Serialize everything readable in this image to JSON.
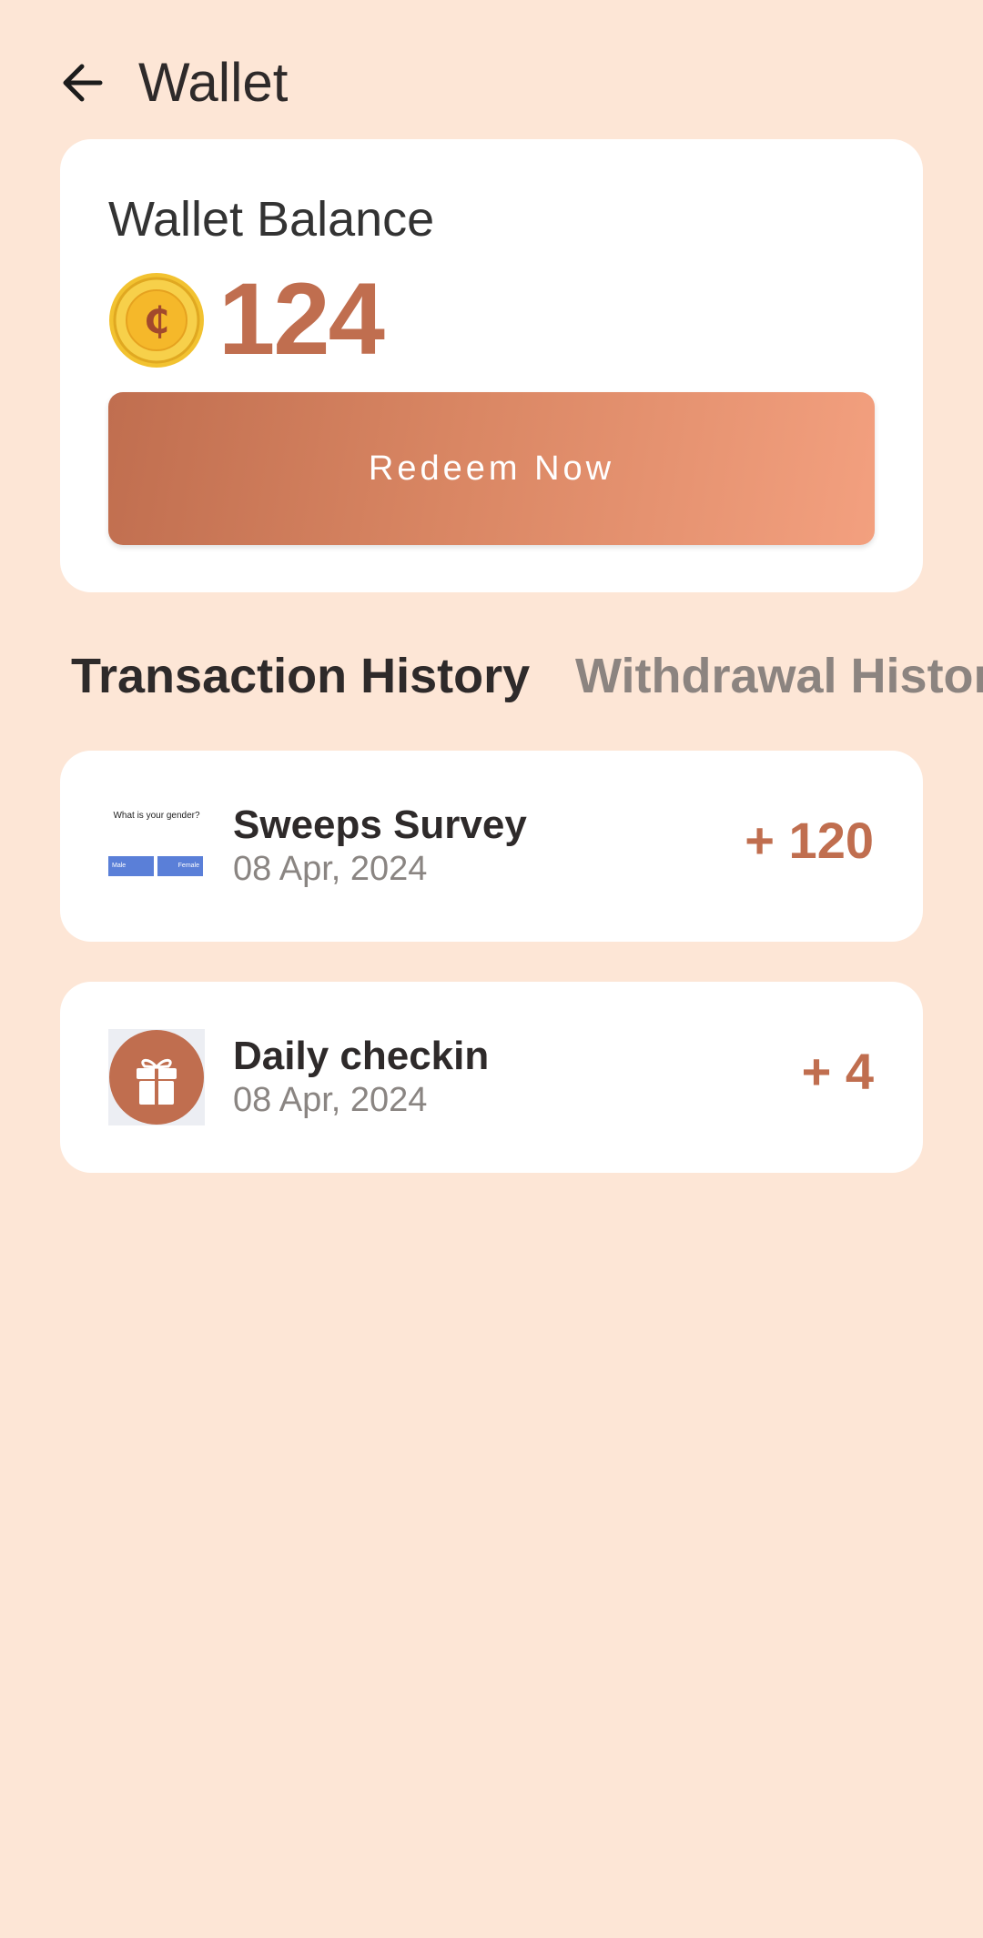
{
  "header": {
    "title": "Wallet",
    "back_icon": "arrow-left-icon"
  },
  "balance_card": {
    "label": "Wallet Balance",
    "coin_icon": "coin-icon",
    "amount": "124",
    "redeem_label": "Redeem Now"
  },
  "tabs": [
    {
      "label": "Transaction History",
      "active": true
    },
    {
      "label": "Withdrawal History",
      "active": false
    }
  ],
  "transactions": [
    {
      "title": "Sweeps Survey",
      "date": "08 Apr, 2024",
      "amount": "+ 120",
      "thumb": {
        "question": "What is your gender?",
        "option_a": "Male",
        "option_b": "Female"
      }
    },
    {
      "title": "Daily checkin",
      "date": "08 Apr, 2024",
      "amount": "+ 4",
      "thumb_icon": "gift-icon"
    }
  ],
  "colors": {
    "background": "#fde6d6",
    "accent": "#c06e4f",
    "card": "#ffffff"
  }
}
